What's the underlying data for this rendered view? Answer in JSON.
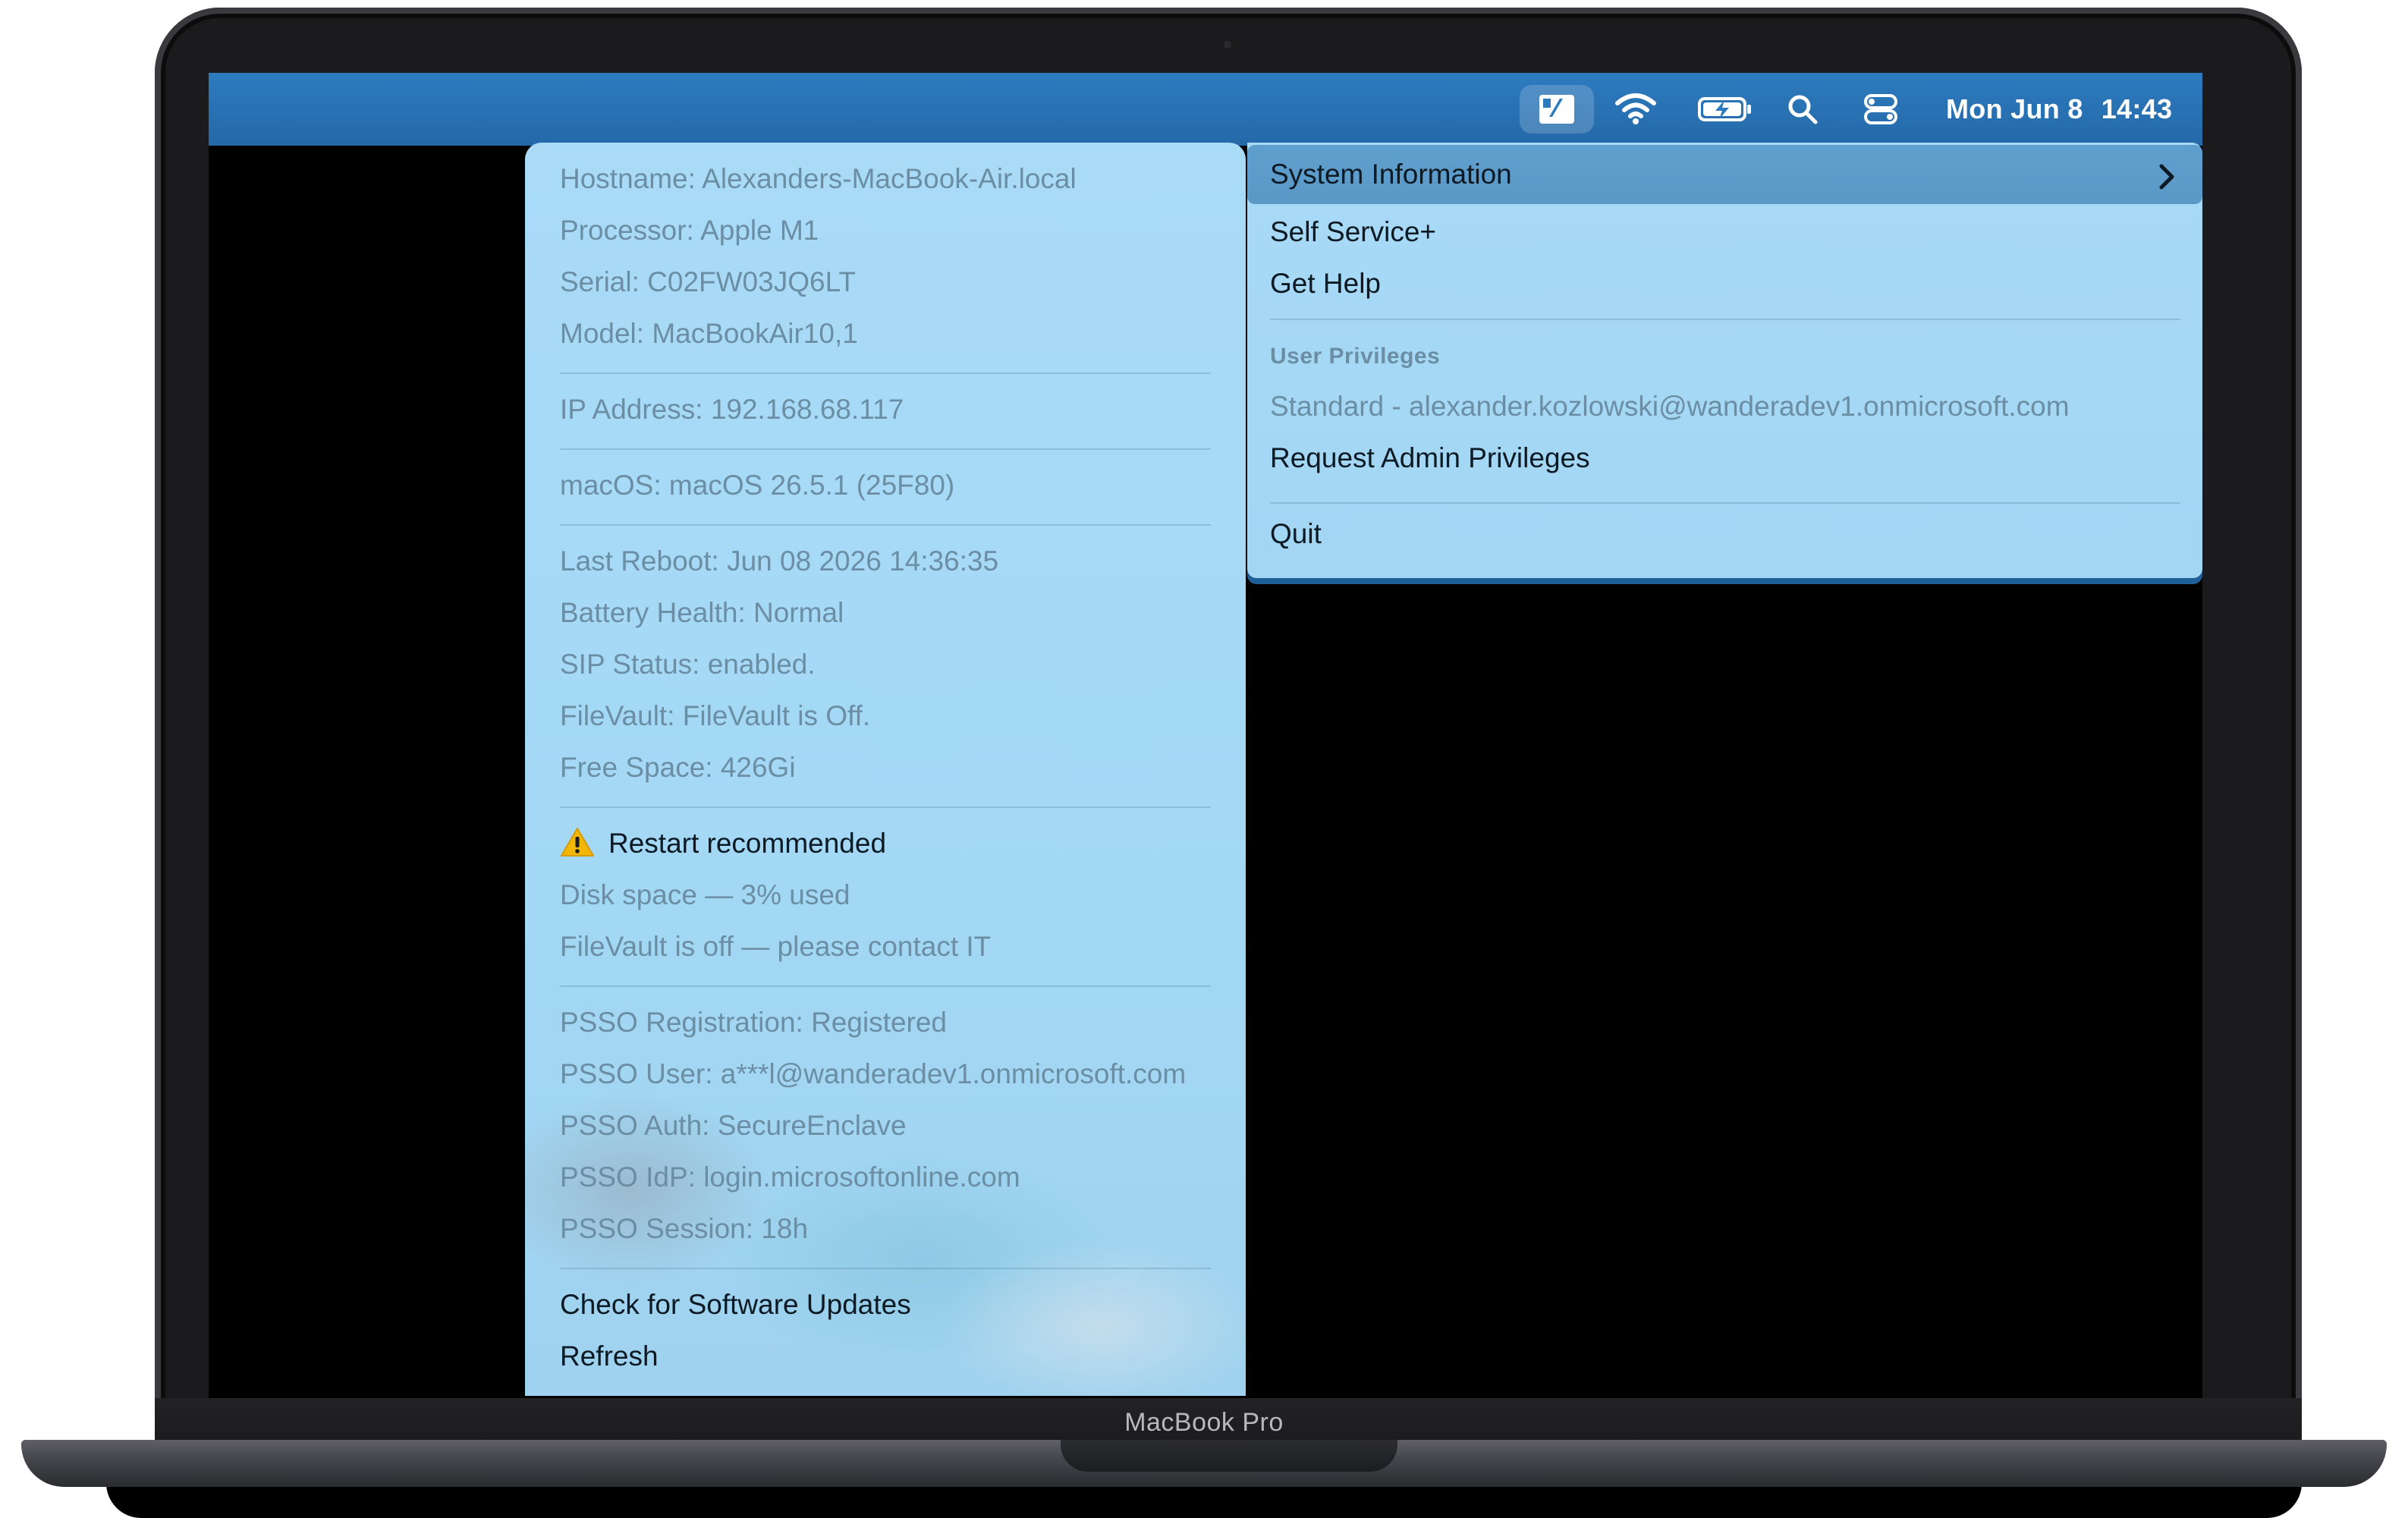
{
  "device_label": "MacBook Pro",
  "menubar": {
    "app_icon": "self-service-app-icon",
    "icons": [
      "wifi-icon",
      "battery-charging-icon",
      "search-icon",
      "control-center-icon"
    ],
    "clock_date": "Mon Jun 8",
    "clock_time": "14:43"
  },
  "info_menu": {
    "system": [
      "Hostname: Alexanders-MacBook-Air.local",
      "Processor: Apple M1",
      "Serial: C02FW03JQ6LT",
      "Model: MacBookAir10,1"
    ],
    "network": [
      "IP Address: 192.168.68.117"
    ],
    "os": [
      "macOS: macOS 26.5.1 (25F80)"
    ],
    "health": [
      "Last Reboot: Jun 08 2026 14:36:35",
      "Battery Health: Normal",
      "SIP Status: enabled.",
      "FileVault: FileVault is Off.",
      "Free Space: 426Gi"
    ],
    "alert": {
      "icon": "warning-icon",
      "title": "Restart recommended",
      "details": [
        "Disk space — 3% used",
        "FileVault is off — please contact IT"
      ]
    },
    "psso": [
      "PSSO Registration: Registered",
      "PSSO User: a***l@wanderadev1.onmicrosoft.com",
      "PSSO Auth: SecureEnclave",
      "PSSO IdP: login.microsoftonline.com",
      "PSSO Session: 18h"
    ],
    "actions": [
      "Check for Software Updates",
      "Refresh"
    ]
  },
  "app_menu": {
    "system_information": "System Information",
    "self_service": "Self Service+",
    "get_help": "Get Help",
    "privileges_header": "User Privileges",
    "privileges_status": "Standard - alexander.kozlowski@wanderadev1.onmicrosoft.com",
    "request_admin": "Request Admin Privileges",
    "quit": "Quit"
  },
  "colors": {
    "menubar": "#2d7bbf",
    "menu_background": "#a9dbf7",
    "highlight": "#5f9fce",
    "warning": "#f2b705"
  }
}
